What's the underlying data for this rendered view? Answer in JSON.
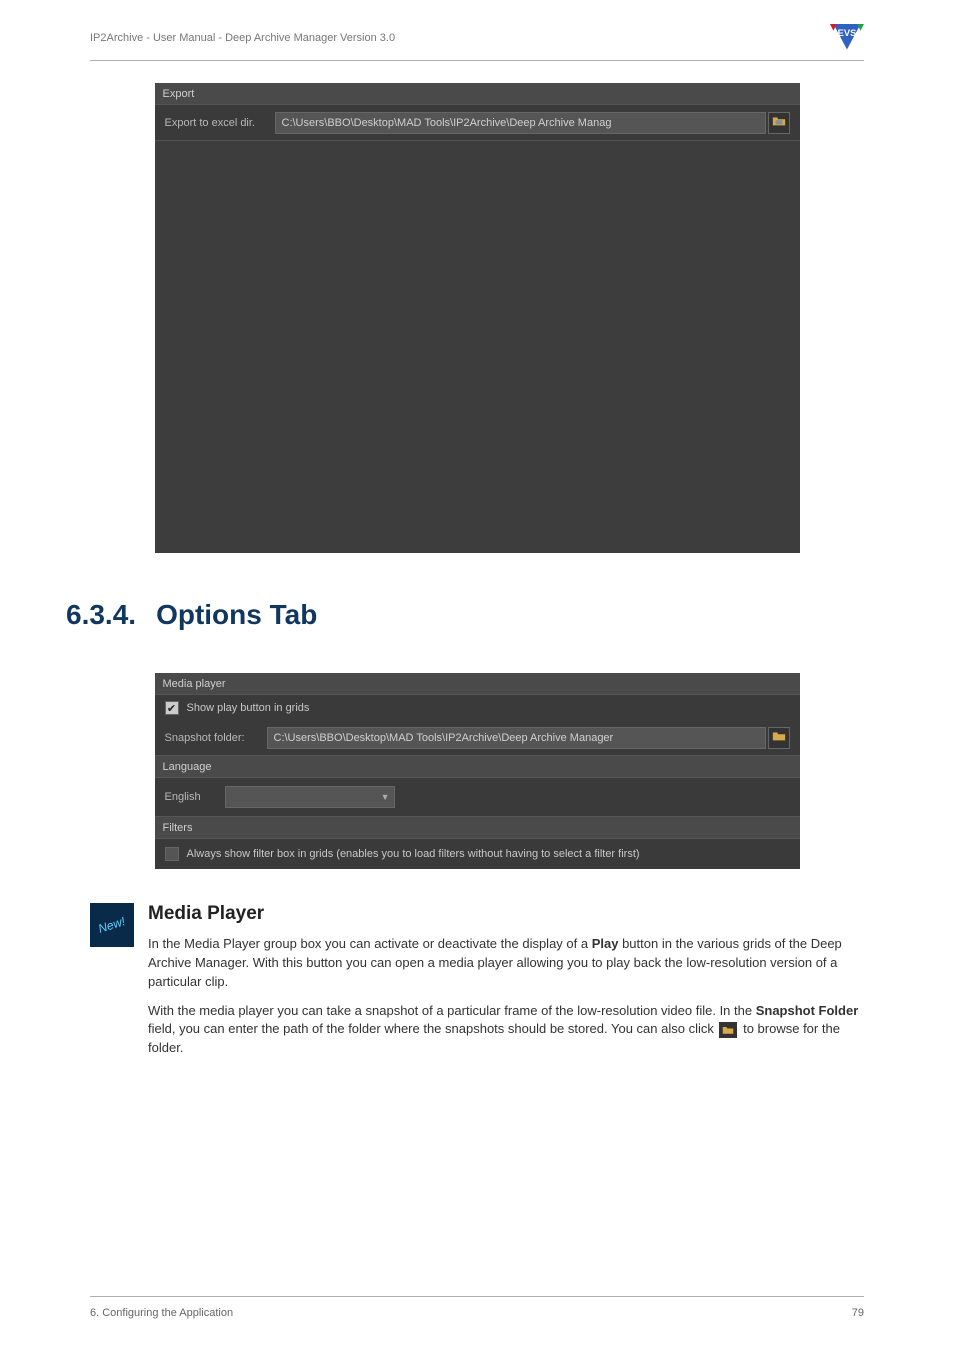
{
  "header": {
    "breadcrumb": "IP2Archive - User Manual - Deep Archive Manager Version 3.0"
  },
  "screenshot_export": {
    "group_title": "Export",
    "row_label": "Export to excel dir.",
    "path_value": "C:\\Users\\BBO\\Desktop\\MAD Tools\\IP2Archive\\Deep Archive Manag"
  },
  "section": {
    "number": "6.3.4.",
    "title": "Options Tab"
  },
  "screenshot_options": {
    "media_group_title": "Media player",
    "show_play_label": "Show play button in grids",
    "snapshot_label": "Snapshot folder:",
    "snapshot_value": "C:\\Users\\BBO\\Desktop\\MAD Tools\\IP2Archive\\Deep Archive Manager",
    "language_group_title": "Language",
    "language_label": "English",
    "filters_group_title": "Filters",
    "filters_checkbox_label": "Always show filter box in grids (enables you to load filters without having to select a filter first)"
  },
  "media_player": {
    "new_badge": "New!",
    "heading": "Media Player",
    "para1_a": "In the Media Player group box you can activate or deactivate the display of a ",
    "para1_b_bold": "Play",
    "para1_c": " button in the various grids of the Deep Archive Manager. With this button you can open a media player allowing you to play back the low-resolution version of a particular clip.",
    "para2_a": "With the media player you can take a snapshot of a particular frame of the low-resolution video file. In the ",
    "para2_b_bold": "Snapshot Folder",
    "para2_c": " field, you can enter the path of the folder where the snapshots should be stored. You can also click ",
    "para2_d": " to browse for the folder."
  },
  "footer": {
    "left": "6. Configuring the Application",
    "right": "79"
  }
}
